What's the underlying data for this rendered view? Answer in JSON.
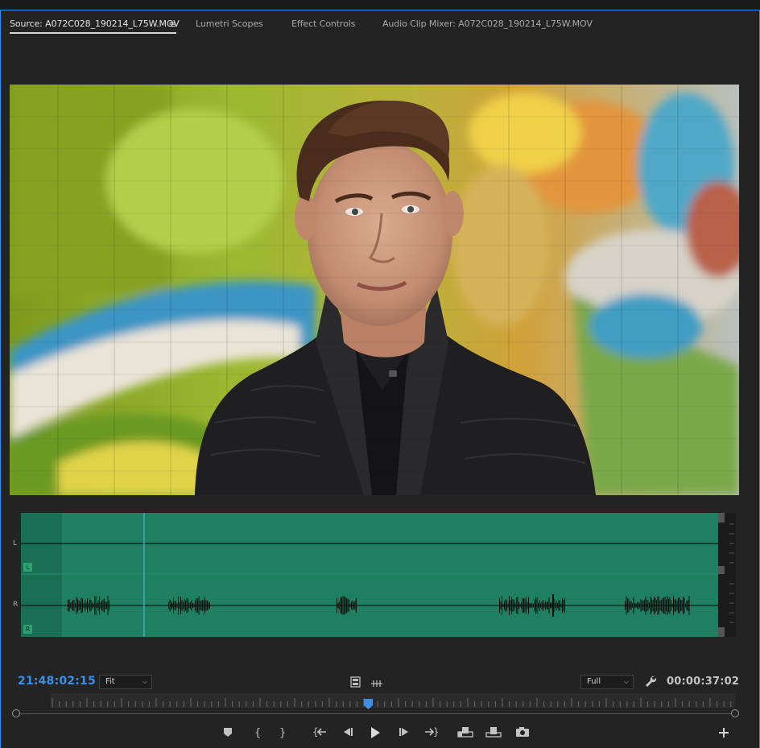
{
  "tabs": {
    "source": "Source: A072C028_190214_L75W.MOV",
    "menu_glyph": "≡",
    "lumetri": "Lumetri Scopes",
    "effect_controls": "Effect Controls",
    "audio_mixer": "Audio Clip Mixer: A072C028_190214_L75W.MOV"
  },
  "waveform": {
    "channel_left": "L",
    "channel_right": "R",
    "color": "#1e8060"
  },
  "controls": {
    "current_timecode": "21:48:02:15",
    "zoom_value": "Fit",
    "resolution_value": "Full",
    "duration_timecode": "00:00:37:02",
    "accent_color": "#3d8fe3"
  },
  "icons": {
    "export_frame": "camera-icon",
    "settings": "wrench-icon",
    "add_button": "plus-icon"
  }
}
